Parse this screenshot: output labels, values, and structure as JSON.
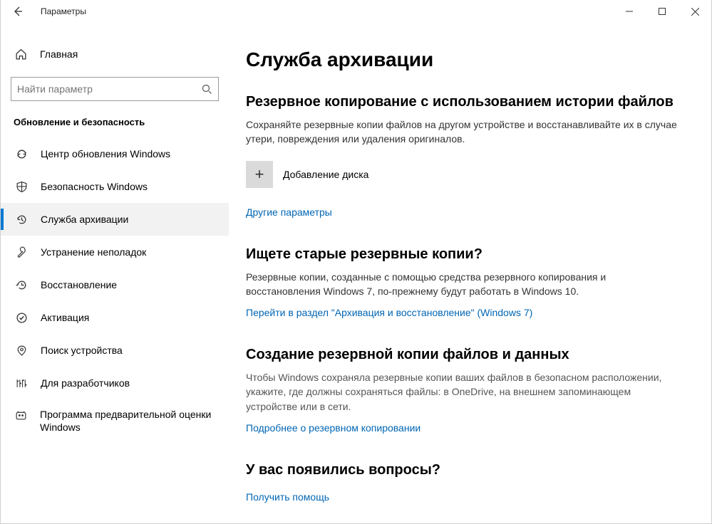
{
  "window": {
    "title": "Параметры"
  },
  "sidebar": {
    "home_label": "Главная",
    "search_placeholder": "Найти параметр",
    "category": "Обновление и безопасность",
    "items": [
      {
        "label": "Центр обновления Windows"
      },
      {
        "label": "Безопасность Windows"
      },
      {
        "label": "Служба архивации"
      },
      {
        "label": "Устранение неполадок"
      },
      {
        "label": "Восстановление"
      },
      {
        "label": "Активация"
      },
      {
        "label": "Поиск устройства"
      },
      {
        "label": "Для разработчиков"
      },
      {
        "label": "Программа предварительной оценки Windows"
      }
    ]
  },
  "page": {
    "title": "Служба архивации",
    "s1": {
      "heading": "Резервное копирование с использованием истории файлов",
      "desc": "Сохраняйте резервные копии файлов на другом устройстве и восстанавливайте их в случае утери, повреждения или удаления оригиналов.",
      "add_disk": "Добавление диска",
      "more_link": "Другие параметры"
    },
    "s2": {
      "heading": "Ищете старые резервные копии?",
      "desc": "Резервные копии, созданные с помощью средства резервного копирования и восстановления Windows 7, по-прежнему будут работать в Windows 10.",
      "link": "Перейти в раздел \"Архивация и восстановление\" (Windows 7)"
    },
    "s3": {
      "heading": "Создание резервной копии файлов и данных",
      "desc": "Чтобы Windows сохраняла резервные копии ваших файлов в безопасном расположении, укажите, где должны сохраняться файлы: в OneDrive, на внешнем запоминающем устройстве или в сети.",
      "link": "Подробнее о резервном копировании"
    },
    "s4": {
      "heading": "У вас появились вопросы?",
      "link": "Получить помощь"
    }
  }
}
